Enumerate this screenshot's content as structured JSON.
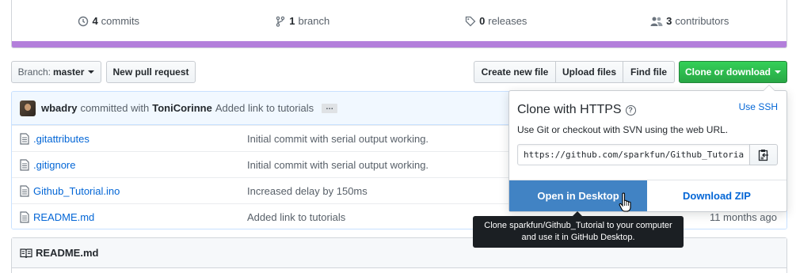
{
  "summary": {
    "commits": {
      "count": "4",
      "label": "commits",
      "icon": "history-icon"
    },
    "branches": {
      "count": "1",
      "label": "branch",
      "icon": "git-branch-icon"
    },
    "releases": {
      "count": "0",
      "label": "releases",
      "icon": "tag-icon"
    },
    "contributors": {
      "count": "3",
      "label": "contributors",
      "icon": "people-icon"
    },
    "language_bar_color": "#b37fdb"
  },
  "toolbar": {
    "branch_prefix": "Branch:",
    "branch_name": "master",
    "new_pull_request": "New pull request",
    "create_new_file": "Create new file",
    "upload_files": "Upload files",
    "find_file": "Find file",
    "clone_or_download": "Clone or download"
  },
  "latest_commit": {
    "author": "wbadry",
    "committed_with": "committed with",
    "coauthor": "ToniCorinne",
    "message": "Added link to tutorials",
    "ellipsis": "…"
  },
  "files": [
    {
      "name": ".gitattributes",
      "message": "Initial commit with serial output working.",
      "age": ""
    },
    {
      "name": ".gitignore",
      "message": "Initial commit with serial output working.",
      "age": ""
    },
    {
      "name": "Github_Tutorial.ino",
      "message": "Increased delay by 150ms",
      "age": ""
    },
    {
      "name": "README.md",
      "message": "Added link to tutorials",
      "age": "11 months ago"
    }
  ],
  "readme": {
    "title": "README.md"
  },
  "clone_popover": {
    "title": "Clone with HTTPS",
    "help": "?",
    "use_ssh": "Use SSH",
    "description": "Use Git or checkout with SVN using the web URL.",
    "url": "https://github.com/sparkfun/Github_Tutorial.git",
    "open_in_desktop": "Open in Desktop",
    "download_zip": "Download ZIP"
  },
  "tooltip": {
    "line1": "Clone sparkfun/Github_Tutorial to your computer",
    "line2": "and use it in GitHub Desktop."
  },
  "colors": {
    "primary_green": "#28a745",
    "link_blue": "#0366d6",
    "desktop_blue": "#4183c4",
    "commit_tease_bg": "#f1f8ff"
  }
}
